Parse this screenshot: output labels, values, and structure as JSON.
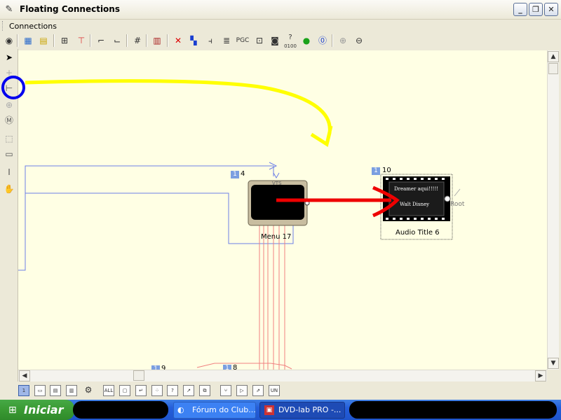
{
  "window": {
    "title": "Floating Connections"
  },
  "menu": {
    "items": [
      "Connections"
    ]
  },
  "toolbar": {
    "pgc_label": "PGC",
    "qcount_label": "?",
    "qcount_sub": "0100"
  },
  "canvas": {
    "menu_node": {
      "badge": "1",
      "number": "4",
      "tag": "VTS",
      "label": "Menu 17"
    },
    "title_node": {
      "badge": "1",
      "number": "10",
      "label": "Audio Title 6",
      "root_label": "Root",
      "thumb_line1": "Dreamer aqui!!!!!",
      "thumb_line2": "Walt Disney"
    },
    "bottom_nodes": [
      {
        "badge": "1",
        "number": "9"
      },
      {
        "badge": "1",
        "number": "8"
      }
    ]
  },
  "bottom_toolbar": {
    "active_label": "1",
    "all_label": "ALL",
    "un_label": "UN"
  },
  "taskbar": {
    "start_label": "Iniciar",
    "tasks": [
      {
        "label": "Fórum do Club..."
      },
      {
        "label": "DVD-lab PRO -..."
      }
    ]
  },
  "colors": {
    "annotation_yellow": "#ffff00",
    "annotation_red": "#ee0000",
    "annotation_blue": "#0000ee",
    "connection_blue": "#6c7fe6",
    "connection_red": "#f08080",
    "canvas_bg": "#ffffe4"
  }
}
